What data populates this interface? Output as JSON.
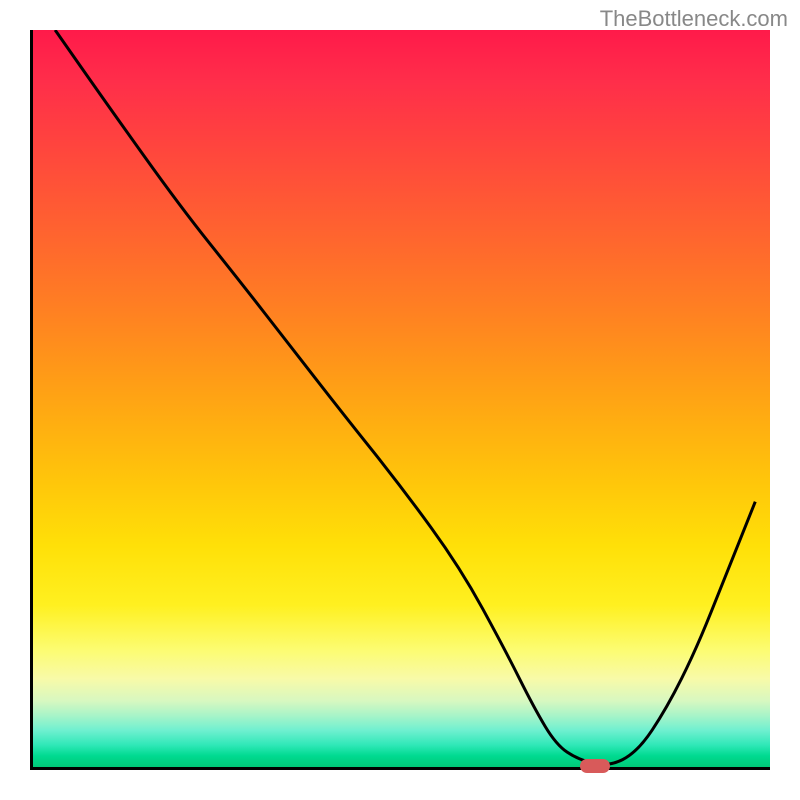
{
  "watermark": "TheBottleneck.com",
  "chart_data": {
    "type": "line",
    "title": "",
    "xlabel": "",
    "ylabel": "",
    "xlim": [
      0,
      100
    ],
    "ylim": [
      0,
      100
    ],
    "background_gradient": {
      "top_color": "#ff1a4a",
      "mid_color": "#ffd000",
      "bottom_color": "#00c878"
    },
    "series": [
      {
        "name": "curve",
        "x": [
          3,
          10,
          20,
          28,
          35,
          42,
          50,
          58,
          64,
          68,
          71,
          74,
          78,
          82,
          86,
          90,
          94,
          98
        ],
        "y": [
          100,
          90,
          76,
          66,
          57,
          48,
          38,
          27,
          16,
          8,
          3,
          1,
          0,
          2,
          8,
          16,
          26,
          36
        ]
      }
    ],
    "marker": {
      "x": 76,
      "y": 0.5,
      "color": "#d85a5a"
    }
  }
}
